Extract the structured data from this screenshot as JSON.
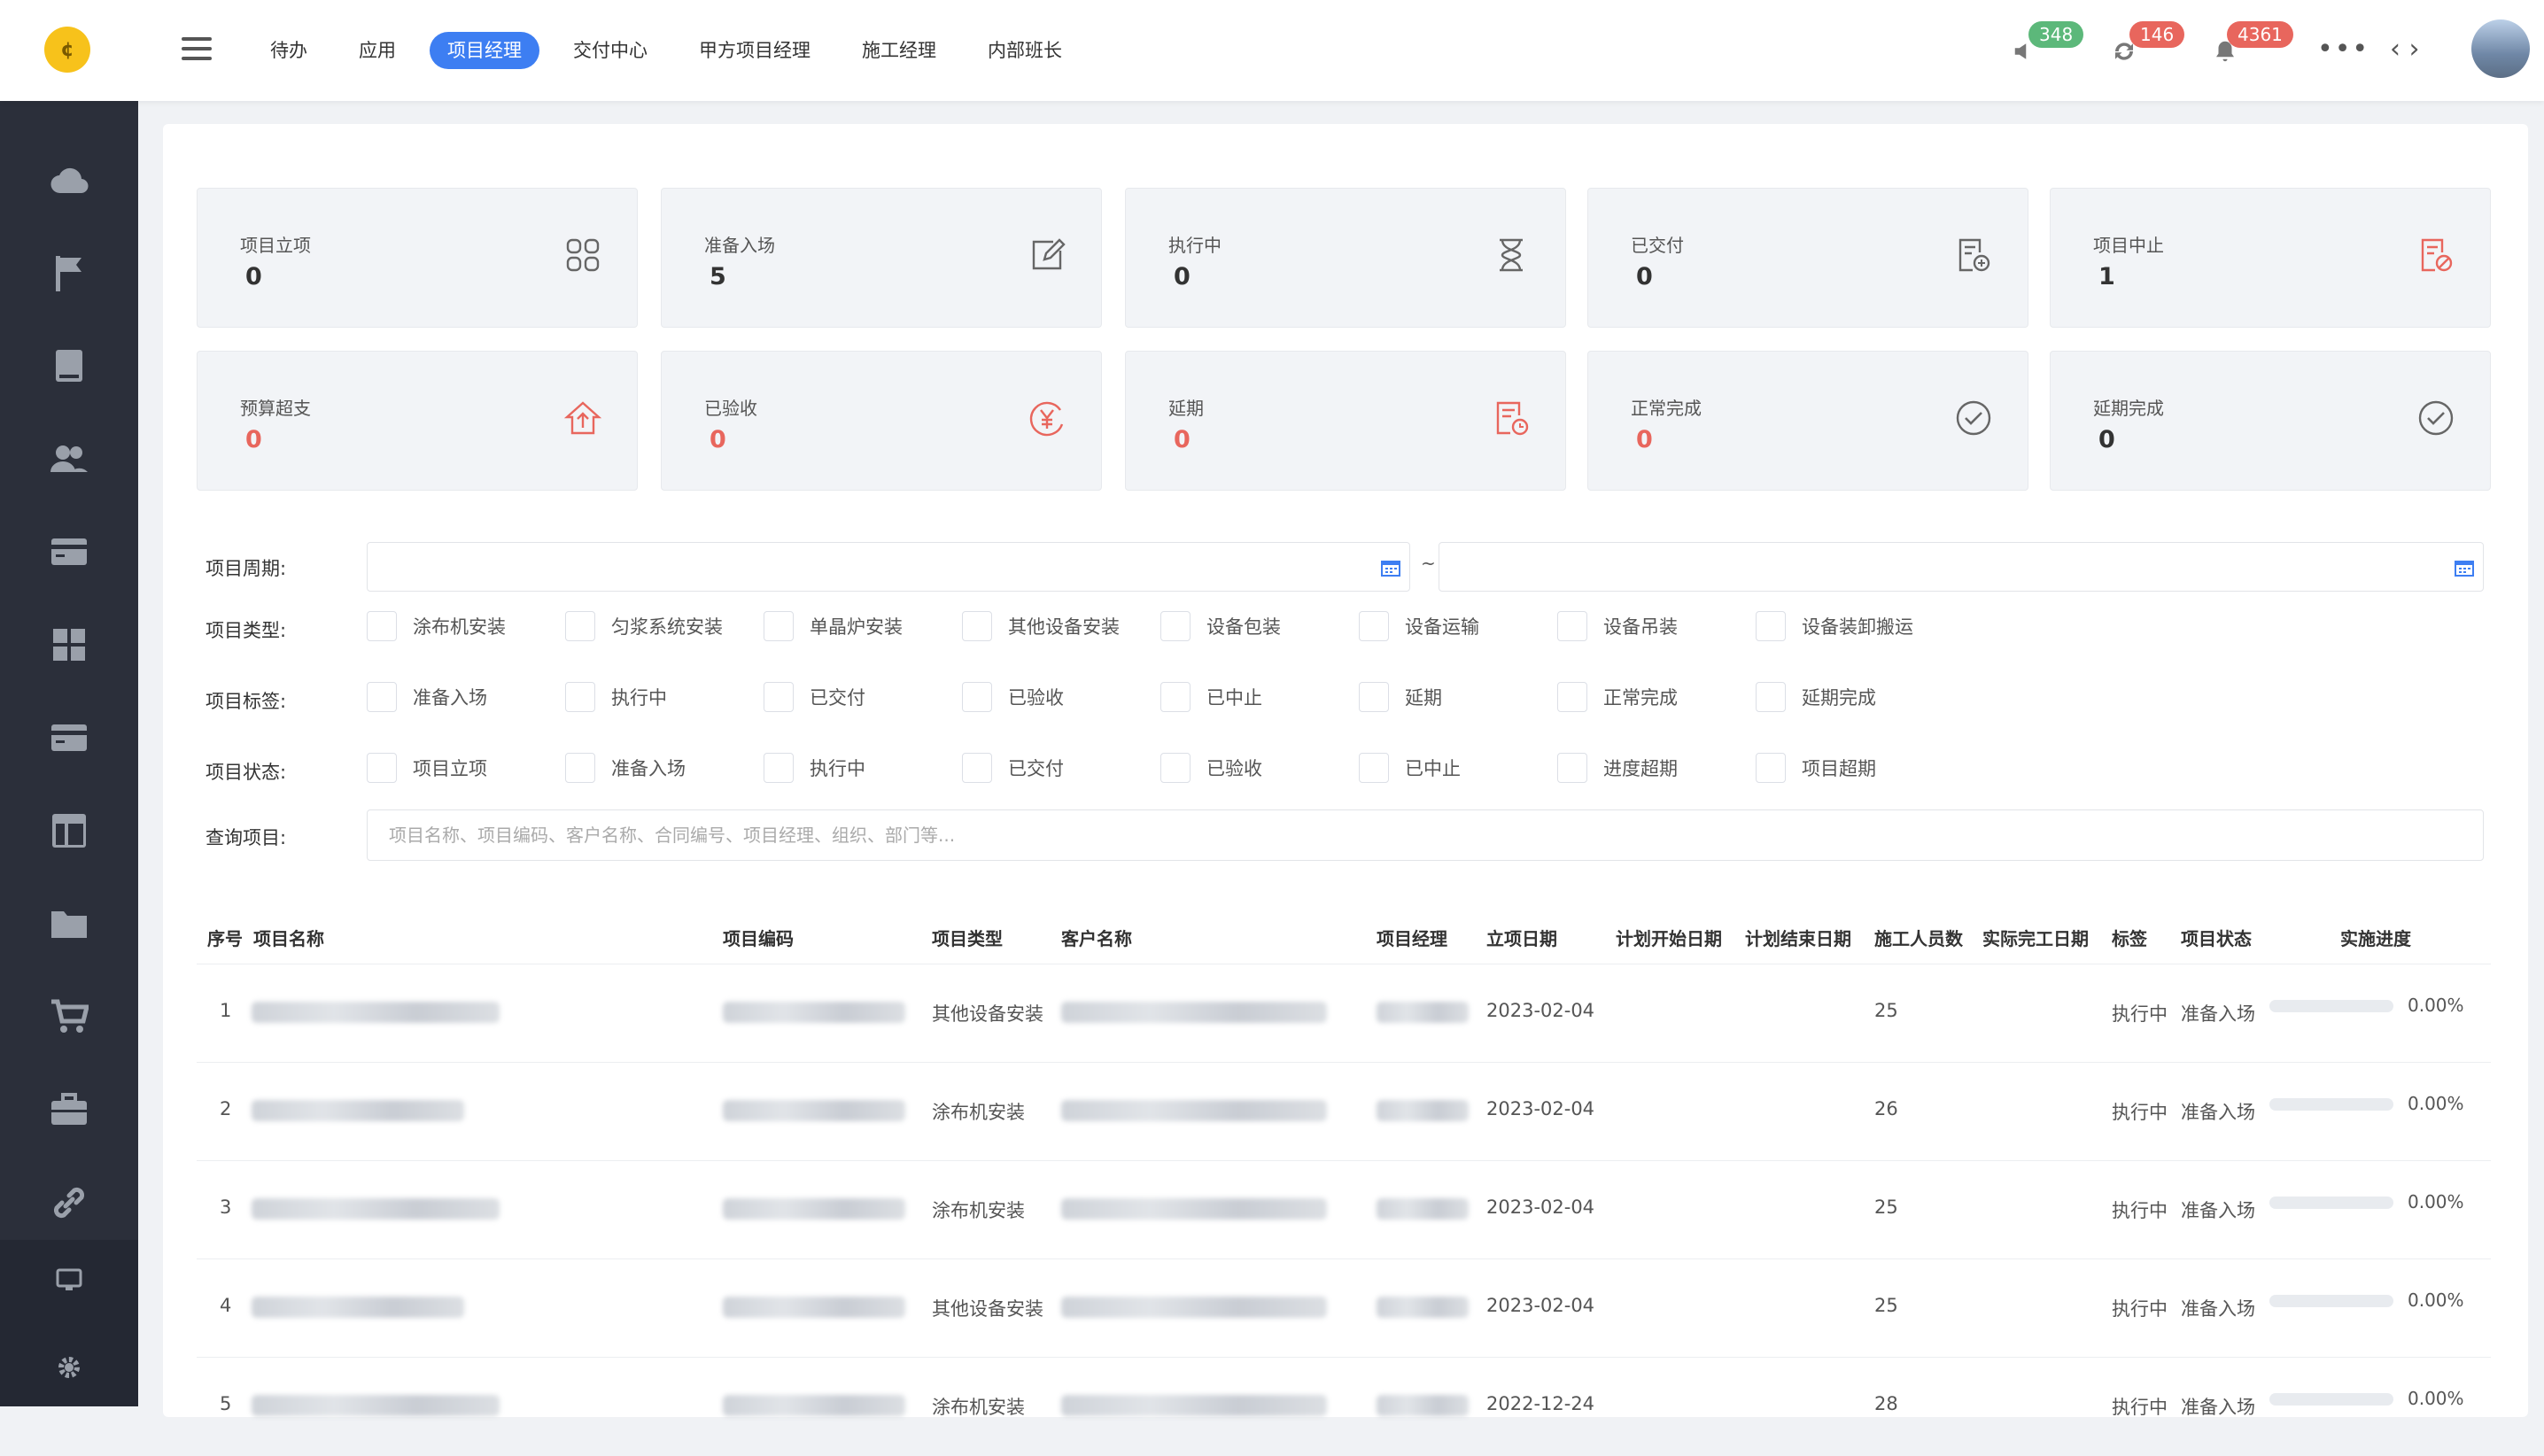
{
  "nav": {
    "items": [
      "待办",
      "应用",
      "项目经理",
      "交付中心",
      "甲方项目经理",
      "施工经理",
      "内部班长"
    ],
    "active": 2
  },
  "header": {
    "badges": {
      "broadcast": "348",
      "sync": "146",
      "bell": "4361"
    },
    "more": "•••",
    "code": "‹ ›"
  },
  "colors": {
    "accent": "#3d7ef2",
    "green_badge": "#5cb87a",
    "red_badge": "#e8665d",
    "sidebar": "#2b2f3a"
  },
  "stats": [
    {
      "label": "项目立项",
      "value": "0",
      "icon": "grid-rounded-icon",
      "red": false
    },
    {
      "label": "准备入场",
      "value": "5",
      "icon": "edit-icon",
      "red": false
    },
    {
      "label": "执行中",
      "value": "0",
      "icon": "hourglass-icon",
      "red": false
    },
    {
      "label": "已交付",
      "value": "0",
      "icon": "doc-check-icon",
      "red": false
    },
    {
      "label": "项目中止",
      "value": "1",
      "icon": "doc-stop-icon",
      "red": false
    },
    {
      "label": "预算超支",
      "value": "0",
      "icon": "house-up-icon",
      "red": true
    },
    {
      "label": "已验收",
      "value": "0",
      "icon": "yuan-icon",
      "red": true
    },
    {
      "label": "延期",
      "value": "0",
      "icon": "doc-clock-icon",
      "red": true
    },
    {
      "label": "正常完成",
      "value": "0",
      "icon": "check-circle-icon",
      "red": true
    },
    {
      "label": "延期完成",
      "value": "0",
      "icon": "check-circle-icon",
      "red": false
    }
  ],
  "filters": {
    "period_label": "项目周期:",
    "tilde": "~",
    "type_label": "项目类型:",
    "types": [
      "涂布机安装",
      "匀浆系统安装",
      "单晶炉安装",
      "其他设备安装",
      "设备包装",
      "设备运输",
      "设备吊装",
      "设备装卸搬运"
    ],
    "tag_label": "项目标签:",
    "tags": [
      "准备入场",
      "执行中",
      "已交付",
      "已验收",
      "已中止",
      "延期",
      "正常完成",
      "延期完成"
    ],
    "status_label": "项目状态:",
    "statuses": [
      "项目立项",
      "准备入场",
      "执行中",
      "已交付",
      "已验收",
      "已中止",
      "进度超期",
      "项目超期"
    ],
    "query_label": "查询项目:",
    "query_placeholder": "项目名称、项目编码、客户名称、合同编号、项目经理、组织、部门等..."
  },
  "table": {
    "headers": [
      "序号",
      "项目名称",
      "项目编码",
      "项目类型",
      "客户名称",
      "项目经理",
      "立项日期",
      "计划开始日期",
      "计划结束日期",
      "施工人员数",
      "实际完工日期",
      "标签",
      "项目状态",
      "实施进度"
    ],
    "rows": [
      {
        "idx": "1",
        "type": "其他设备安装",
        "date": "2023-02-04",
        "workers": "25",
        "tag": "执行中",
        "status": "准备入场",
        "progress": "0.00%"
      },
      {
        "idx": "2",
        "type": "涂布机安装",
        "date": "2023-02-04",
        "workers": "26",
        "tag": "执行中",
        "status": "准备入场",
        "progress": "0.00%"
      },
      {
        "idx": "3",
        "type": "涂布机安装",
        "date": "2023-02-04",
        "workers": "25",
        "tag": "执行中",
        "status": "准备入场",
        "progress": "0.00%"
      },
      {
        "idx": "4",
        "type": "其他设备安装",
        "date": "2023-02-04",
        "workers": "25",
        "tag": "执行中",
        "status": "准备入场",
        "progress": "0.00%"
      },
      {
        "idx": "5",
        "type": "涂布机安装",
        "date": "2022-12-24",
        "workers": "28",
        "tag": "执行中",
        "status": "准备入场",
        "progress": "0.00%"
      }
    ]
  }
}
